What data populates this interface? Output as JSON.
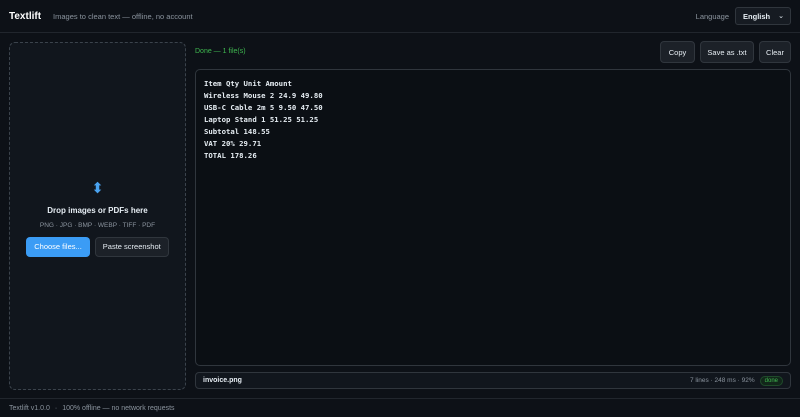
{
  "header": {
    "brand": "Textlift",
    "tagline": "Images to clean text — offline, no account",
    "language_label": "Language",
    "language_value": "English"
  },
  "dropzone": {
    "icon": "up-down-arrow-icon",
    "title": "Drop images or PDFs here",
    "formats": "PNG · JPG · BMP · WEBP · TIFF · PDF",
    "choose_label": "Choose files...",
    "paste_label": "Paste screenshot"
  },
  "status": "Done — 1 file(s)",
  "toolbar": {
    "copy_label": "Copy",
    "save_label": "Save as .txt",
    "clear_label": "Clear"
  },
  "output_lines": [
    "Item Qty Unit Amount",
    "Wireless Mouse 2 24.9 49.80",
    "USB-C Cable 2m 5 9.50 47.50",
    "Laptop Stand 1 51.25 51.25",
    "Subtotal 148.55",
    "VAT 20% 29.71",
    "TOTAL 178.26"
  ],
  "file": {
    "name": "invoice.png",
    "meta": "7 lines · 248 ms · 92%",
    "badge": "done"
  },
  "footer": {
    "version": "Textlift v1.0.0",
    "separator": "·",
    "note": "100% offline — no network requests"
  },
  "colors": {
    "accent": "#3b9cf5",
    "success": "#3fb950",
    "background": "#0d1117"
  }
}
